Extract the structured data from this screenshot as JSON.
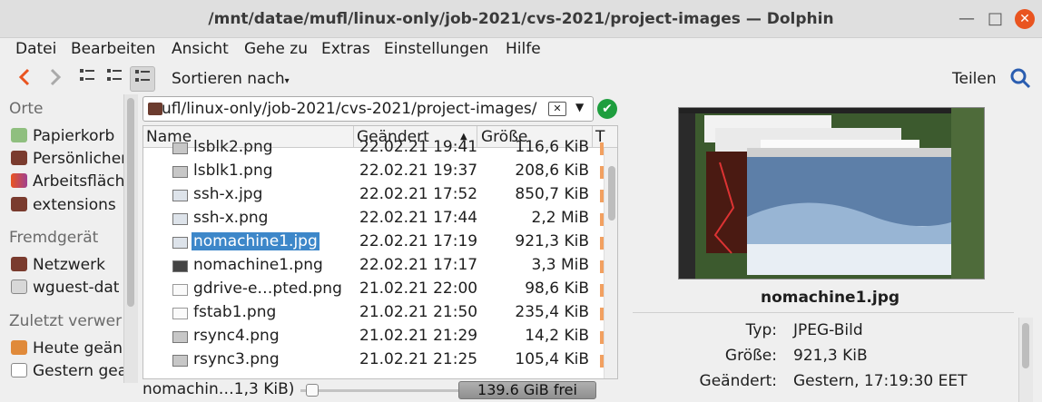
{
  "window": {
    "title": "/mnt/datae/mufl/linux-only/job-2021/cvs-2021/project-images — Dolphin"
  },
  "menu": [
    "Datei",
    "Bearbeiten",
    "Ansicht",
    "Gehe zu",
    "Extras",
    "Einstellungen",
    "Hilfe"
  ],
  "toolbar": {
    "sort_label": "Sortieren nach",
    "share_label": "Teilen"
  },
  "places": {
    "section_places": "Orte",
    "items": [
      {
        "label": "Papierkorb",
        "icon": "trash-icon"
      },
      {
        "label": "Persönlicher",
        "icon": "home-folder-icon"
      },
      {
        "label": "Arbeitsfläch",
        "icon": "desktop-folder-icon"
      },
      {
        "label": "extensions",
        "icon": "folder-icon"
      }
    ],
    "section_remote": "Fremdgerät",
    "remote_items": [
      {
        "label": "Netzwerk",
        "icon": "network-folder-icon"
      },
      {
        "label": "wguest-dat",
        "icon": "drive-icon"
      }
    ],
    "section_recent": "Zuletzt verwer",
    "recent_items": [
      {
        "label": "Heute geän",
        "icon": "history-icon"
      },
      {
        "label": "Gestern gea",
        "icon": "calendar-icon"
      }
    ]
  },
  "location": {
    "path": "ufl/linux-only/job-2021/cvs-2021/project-images/"
  },
  "columns": {
    "name": "Name",
    "modified": "Geändert",
    "size": "Größe",
    "type": "T"
  },
  "files": [
    {
      "name": "lsblk2.png",
      "modified": "22.02.21 19:41",
      "size": "116,6 KiB",
      "icon": "gray"
    },
    {
      "name": "lsblk1.png",
      "modified": "22.02.21 19:37",
      "size": "208,6 KiB",
      "icon": "gray"
    },
    {
      "name": "ssh-x.jpg",
      "modified": "22.02.21 17:52",
      "size": "850,7 KiB",
      "icon": "img"
    },
    {
      "name": "ssh-x.png",
      "modified": "22.02.21 17:44",
      "size": "2,2 MiB",
      "icon": "img"
    },
    {
      "name": "nomachine1.jpg",
      "modified": "22.02.21 17:19",
      "size": "921,3 KiB",
      "icon": "img",
      "selected": true
    },
    {
      "name": "nomachine1.png",
      "modified": "22.02.21 17:17",
      "size": "3,3 MiB",
      "icon": "dark"
    },
    {
      "name": "gdrive-e…pted.png",
      "modified": "21.02.21 22:00",
      "size": "98,6 KiB",
      "icon": "doc"
    },
    {
      "name": "fstab1.png",
      "modified": "21.02.21 21:50",
      "size": "235,4 KiB",
      "icon": "doc"
    },
    {
      "name": "rsync4.png",
      "modified": "21.02.21 21:29",
      "size": "14,2 KiB",
      "icon": "gray"
    },
    {
      "name": "rsync3.png",
      "modified": "21.02.21 21:25",
      "size": "105,4 KiB",
      "icon": "gray"
    }
  ],
  "status": {
    "text": "nomachin…1,3 KiB)",
    "free_space": "139.6 GiB frei",
    "zoom_level": 0.02
  },
  "preview": {
    "filename": "nomachine1.jpg",
    "meta": [
      {
        "key": "Typ:",
        "value": "JPEG-Bild"
      },
      {
        "key": "Größe:",
        "value": "921,3 KiB"
      },
      {
        "key": "Geändert:",
        "value": "Gestern, 17:19:30 EET"
      }
    ]
  }
}
